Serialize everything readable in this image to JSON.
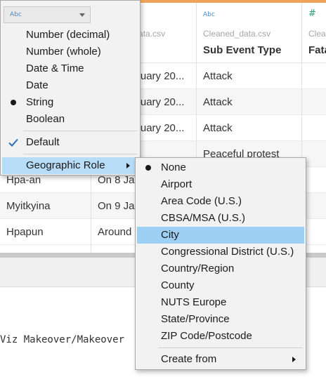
{
  "columns": [
    {
      "type_icon": "Abc",
      "source": "",
      "name": "",
      "cells": [
        "",
        "",
        "",
        "",
        "Hpa-an",
        "Myitkyina",
        "Hpapun"
      ]
    },
    {
      "type_icon": "Abc",
      "source": "Cleaned_data.csv",
      "name": "",
      "cells": [
        "On 8 January 20...",
        "On 8 January 20...",
        "On 8 January 20...",
        "",
        "On 8 Ja",
        "On 9 Ja",
        "Around"
      ]
    },
    {
      "type_icon": "Abc",
      "source": "Cleaned_data.csv",
      "name": "Sub Event Type",
      "cells": [
        "Attack",
        "Attack",
        "Attack",
        "Peaceful protest",
        "",
        "",
        ""
      ]
    },
    {
      "type_icon": "#",
      "source": "Clea",
      "name": "Fata",
      "cells": [
        "",
        "",
        "",
        "",
        "",
        "",
        ""
      ]
    }
  ],
  "bottom_panel": {
    "path_text": "Viz Makeover/Makeover"
  },
  "header_dropdown": {
    "type_icon": "Abc"
  },
  "data_type_menu": {
    "items": [
      {
        "label": "Number (decimal)"
      },
      {
        "label": "Number (whole)"
      },
      {
        "label": "Date & Time"
      },
      {
        "label": "Date"
      },
      {
        "label": "String",
        "selected": true
      },
      {
        "label": "Boolean"
      },
      {
        "label": "Default",
        "checked": true
      },
      {
        "label": "Geographic Role",
        "submenu": true,
        "highlighted": true
      }
    ]
  },
  "geo_role_menu": {
    "items": [
      {
        "label": "None",
        "selected": true
      },
      {
        "label": "Airport"
      },
      {
        "label": "Area Code (U.S.)"
      },
      {
        "label": "CBSA/MSA (U.S.)"
      },
      {
        "label": "City",
        "highlighted": true
      },
      {
        "label": "Congressional District (U.S.)"
      },
      {
        "label": "Country/Region"
      },
      {
        "label": "County"
      },
      {
        "label": "NUTS Europe"
      },
      {
        "label": "State/Province"
      },
      {
        "label": "ZIP Code/Postcode"
      },
      {
        "label": "Create from",
        "submenu": true
      }
    ]
  },
  "colors": {
    "accent_bar": "#f0a35a",
    "menu_highlight": "#b7dcf7",
    "string_icon": "#4b8ac9",
    "number_icon": "#2e9f73"
  }
}
